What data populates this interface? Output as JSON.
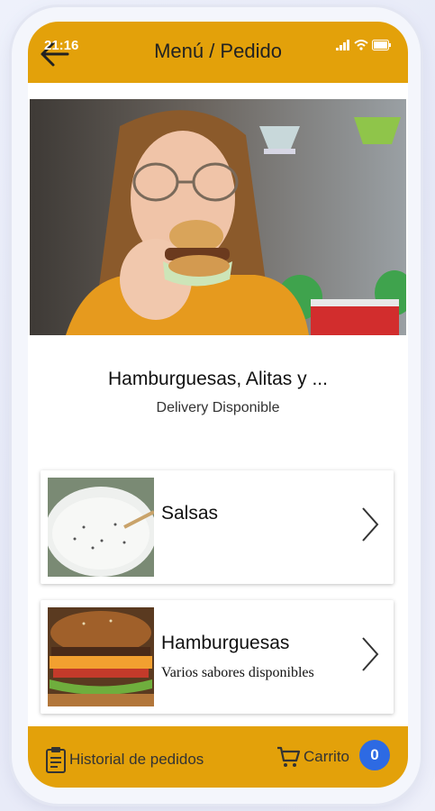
{
  "status_bar": {
    "time": "21:16"
  },
  "header": {
    "title": "Menú / Pedido"
  },
  "store": {
    "name": "Hamburguesas, Alitas y ...",
    "subtitle": "Delivery Disponible"
  },
  "categories": [
    {
      "title": "Salsas",
      "subtitle": ""
    },
    {
      "title": "Hamburguesas",
      "subtitle": "Varios sabores disponibles"
    }
  ],
  "bottom_bar": {
    "history_label": "Historial de pedidos",
    "cart_label": "Carrito",
    "cart_count": "0"
  },
  "colors": {
    "accent": "#e3a10a",
    "badge": "#2d6ae3"
  }
}
